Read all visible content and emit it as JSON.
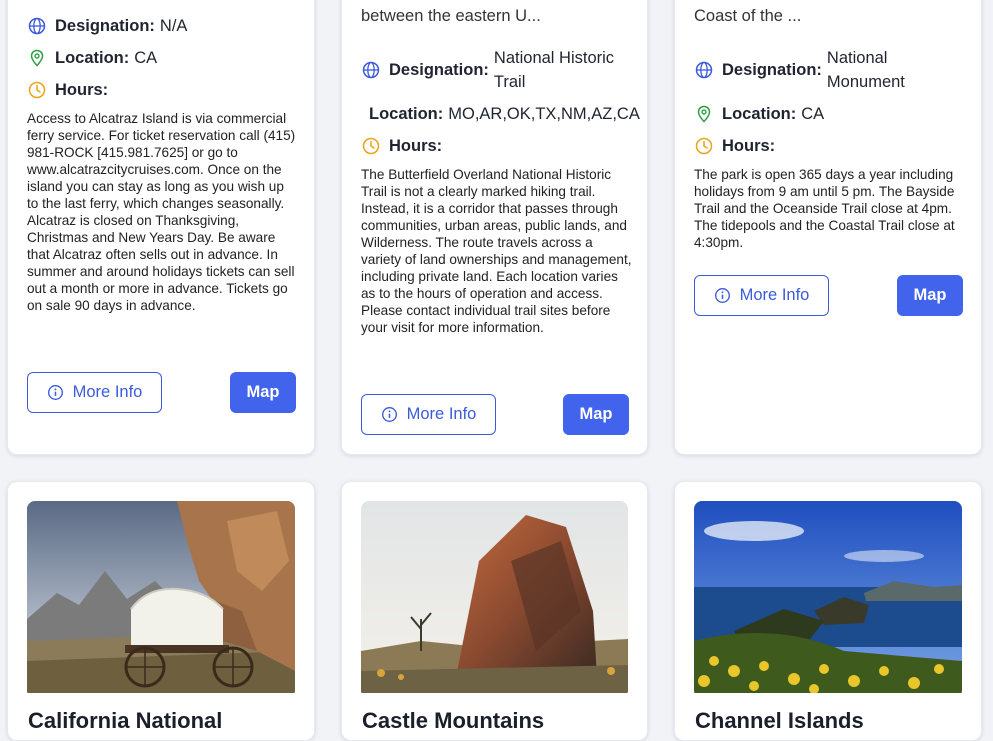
{
  "labels": {
    "designation": "Designation:",
    "location": "Location:",
    "hours": "Hours:",
    "more_info": "More Info",
    "map": "Map"
  },
  "cards": [
    {
      "designation": "N/A",
      "location": "CA",
      "hours_text": "Access to Alcatraz Island is via commercial ferry service. For ticket reservation call (415) 981-ROCK [415.981.7625] or go to www.alcatrazcitycruises.com. Once on the island you can stay as long as you wish up to the last ferry, which changes seasonally. Alcatraz is closed on Thanksgiving, Christmas and New Years Day. Be aware that Alcatraz often sells out in advance. In summer and around holidays tickets can sell out a month or more in advance. Tickets go on sale 90 days in advance."
    },
    {
      "snippet": "between the eastern U...",
      "designation": "National Historic Trail",
      "location": "MO,AR,OK,TX,NM,AZ,CA",
      "hours_text": "The Butterfield Overland National Historic Trail is not a clearly marked hiking trail. Instead, it is a corridor that passes through communities, urban areas, public lands, and Wilderness. The route travels across a variety of land ownerships and management, including private land. Each location varies as to the hours of operation and access. Please contact individual trail sites before your visit for more information."
    },
    {
      "snippet": "Coast of the ...",
      "designation": "National Monument",
      "location": "CA",
      "hours_text": "The park is open 365 days a year including holidays from 9 am until 5 pm. The Bayside Trail and the Oceanside Trail close at 4pm. The tidepools and the Coastal Trail close at 4:30pm."
    },
    {
      "title": "California National"
    },
    {
      "title": "Castle Mountains"
    },
    {
      "title": "Channel Islands"
    }
  ],
  "colors": {
    "accent": "#4263eb",
    "globe_icon": "#3b5bdb",
    "pin_icon": "#2f9e44",
    "clock_icon": "#e8a317"
  }
}
